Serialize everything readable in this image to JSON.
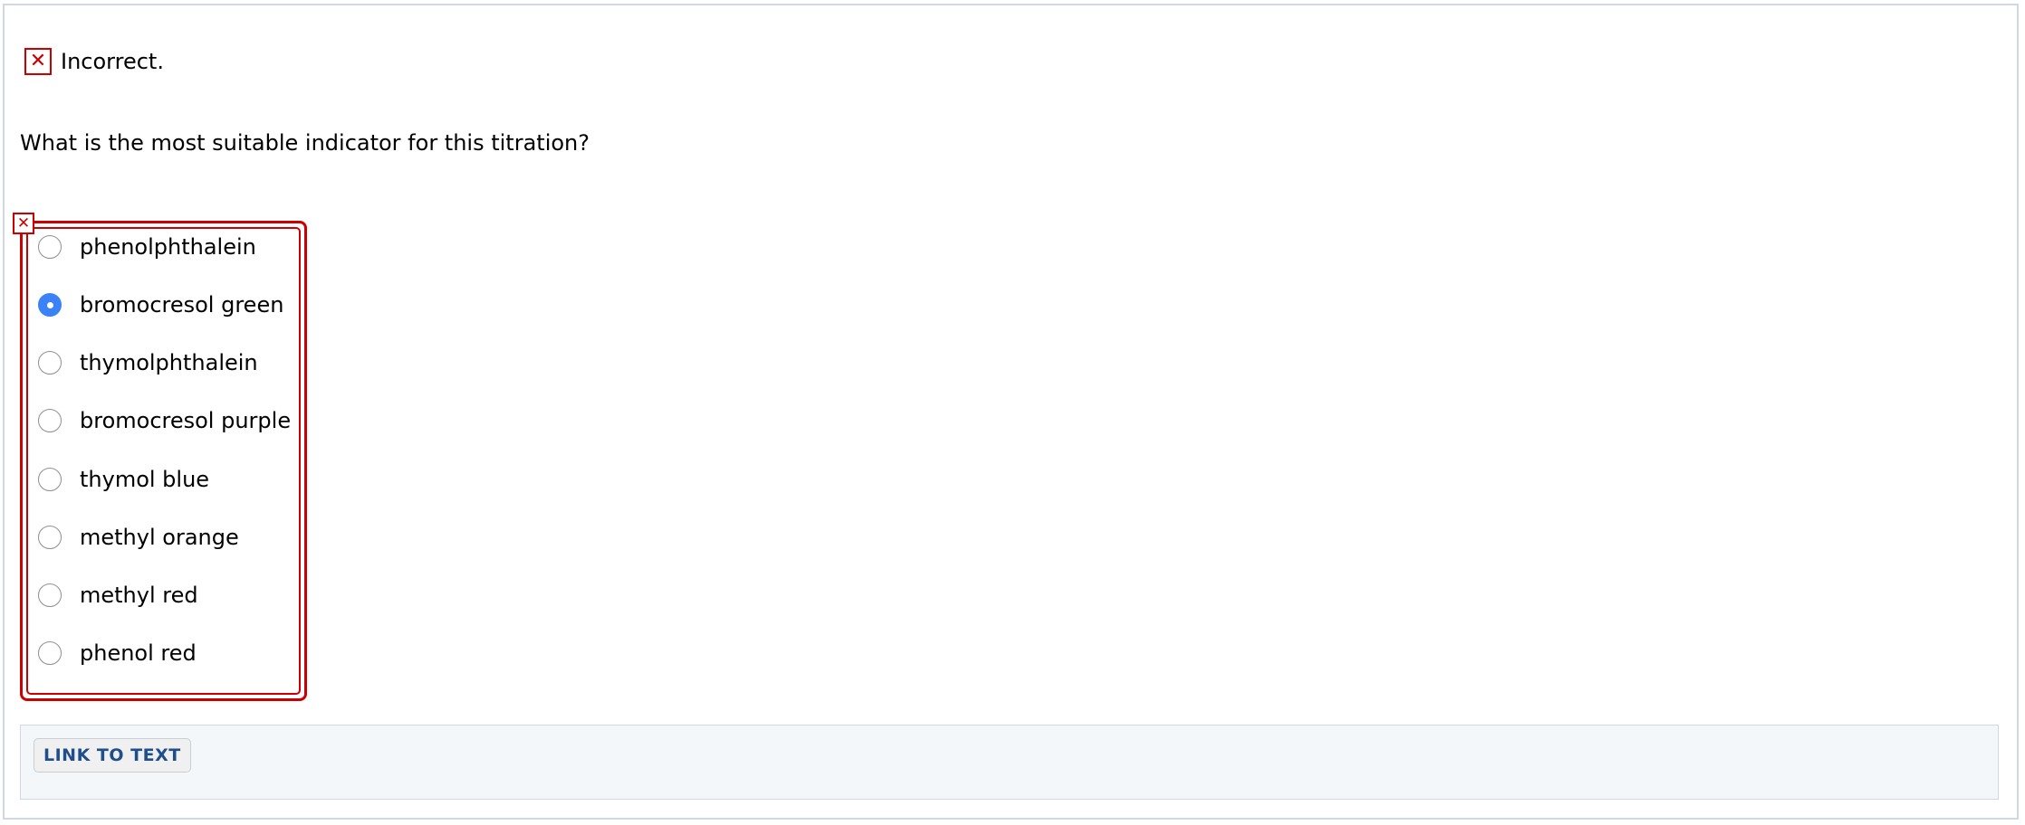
{
  "feedback": {
    "status_icon": "x-mark-icon",
    "status_text": "Incorrect.",
    "status_color": "#cc0000"
  },
  "question": {
    "text": "What is the most suitable indicator for this titration?"
  },
  "answer_box": {
    "flag_icon": "x-mark-icon",
    "border_color": "#cc0000"
  },
  "choices": [
    {
      "label": "phenolphthalein",
      "selected": false
    },
    {
      "label": "bromocresol green",
      "selected": true
    },
    {
      "label": "thymolphthalein",
      "selected": false
    },
    {
      "label": "bromocresol purple",
      "selected": false
    },
    {
      "label": "thymol blue",
      "selected": false
    },
    {
      "label": "methyl orange",
      "selected": false
    },
    {
      "label": "methyl red",
      "selected": false
    },
    {
      "label": "phenol red",
      "selected": false
    }
  ],
  "footer": {
    "link_button_label": "LINK TO TEXT"
  },
  "colors": {
    "selected_radio": "#3b82f6",
    "panel_border": "#cfd8e3",
    "footer_background": "#f4f7fa",
    "link_text": "#1f4e8c"
  }
}
